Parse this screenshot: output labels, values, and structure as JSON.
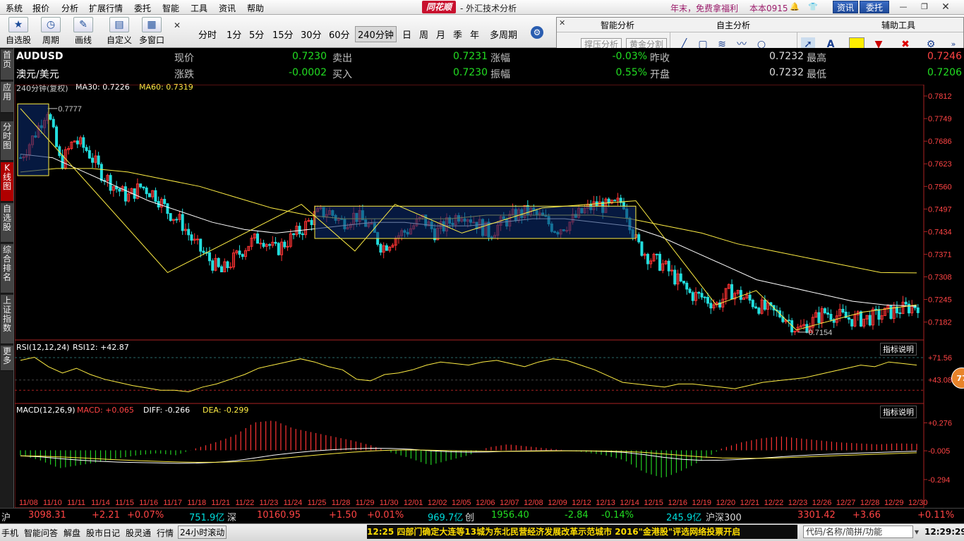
{
  "menu": {
    "items": [
      "系统",
      "报价",
      "分析",
      "扩展行情",
      "委托",
      "智能",
      "工具",
      "资讯",
      "帮助"
    ],
    "brand": "同花顺",
    "title": "- 外汇技术分析",
    "promo": "年末，免费拿福利",
    "user": "本本0915",
    "btn_news": "资讯",
    "btn_trade": "委托"
  },
  "toolbar": {
    "groups": [
      {
        "label": "自选股",
        "icon": "star-icon"
      },
      {
        "label": "周期",
        "icon": "clock-icon"
      },
      {
        "label": "画线",
        "icon": "pencil-icon"
      },
      {
        "label": "自定义",
        "icon": "custom-icon"
      },
      {
        "label": "多窗口",
        "icon": "window-icon"
      }
    ],
    "periods": [
      "分时",
      "1分",
      "5分",
      "15分",
      "30分",
      "60分",
      "240分钟",
      "日",
      "周",
      "月",
      "季",
      "年",
      "多周期"
    ],
    "active_period": "240分钟"
  },
  "panel": {
    "tabs": [
      "智能分析",
      "自主分析",
      "辅助工具"
    ],
    "buttons": [
      "撑压分析",
      "黄金分割"
    ],
    "tool_color": "#ffee00"
  },
  "sidetabs": [
    "首页",
    "应用",
    "分时图",
    "K线图",
    "自选股",
    "综合排名",
    "上证指数",
    "更多"
  ],
  "active_sidetab": "K线图",
  "quote": {
    "symbol": "AUDUSD",
    "name": "澳元/美元",
    "labels": [
      "现价",
      "涨跌",
      "卖出",
      "买入",
      "涨幅",
      "振幅",
      "昨收",
      "开盘",
      "最高",
      "最低"
    ],
    "current": "0.7230",
    "change": "-0.0002",
    "ask": "0.7231",
    "bid": "0.7230",
    "change_pct": "-0.03%",
    "amplitude": "0.55%",
    "prev_close": "0.7232",
    "open": "0.7232",
    "high": "0.7246",
    "low": "0.7206"
  },
  "chart_header": {
    "period": "240分钟(复权)",
    "ma30_label": "MA30: 0.7226",
    "ma60_label": "MA60: 0.7319"
  },
  "rsi_header": {
    "label": "RSI(12,12,24)",
    "value": "RSI12: +42.87",
    "help": "指标说明"
  },
  "macd_header": {
    "label": "MACD(12,26,9)",
    "macd": "MACD: +0.065",
    "diff": "DIFF: -0.266",
    "dea": "DEA: -0.299",
    "help": "指标说明"
  },
  "chart_data": [
    {
      "type": "candlestick",
      "ylim": [
        0.714,
        0.782
      ],
      "yticks": [
        "0.7812",
        "0.7749",
        "0.7686",
        "0.7623",
        "0.7560",
        "0.7497",
        "0.7434",
        "0.7371",
        "0.7308",
        "0.7245",
        "0.7182"
      ],
      "annotations": [
        {
          "text": "0.7777",
          "value": 0.7777
        },
        {
          "text": "0.7154",
          "value": 0.7154
        }
      ],
      "x_labels": [
        "11/08",
        "11/10",
        "11/11",
        "11/14",
        "11/15",
        "11/16",
        "11/17",
        "11/18",
        "11/21",
        "11/22",
        "11/23",
        "11/24",
        "11/25",
        "11/28",
        "11/29",
        "11/30",
        "12/01",
        "12/02",
        "12/05",
        "12/06",
        "12/07",
        "12/08",
        "12/09",
        "12/12",
        "12/13",
        "12/14",
        "12/15",
        "12/16",
        "12/19",
        "12/20",
        "12/21",
        "12/22",
        "12/23",
        "12/26",
        "12/27",
        "12/28",
        "12/29",
        "12/30"
      ],
      "anchor_prices": [
        0.764,
        0.77,
        0.7777,
        0.762,
        0.769,
        0.766,
        0.76,
        0.756,
        0.753,
        0.756,
        0.754,
        0.749,
        0.746,
        0.74,
        0.736,
        0.732,
        0.736,
        0.74,
        0.742,
        0.738,
        0.741,
        0.744,
        0.748,
        0.749,
        0.746,
        0.748,
        0.745,
        0.739,
        0.742,
        0.744,
        0.747,
        0.743,
        0.746,
        0.749,
        0.746,
        0.743,
        0.746,
        0.748,
        0.749,
        0.747,
        0.744,
        0.746,
        0.749,
        0.751,
        0.75,
        0.752,
        0.74,
        0.736,
        0.734,
        0.73,
        0.726,
        0.725,
        0.723,
        0.727,
        0.725,
        0.723,
        0.721,
        0.72,
        0.716,
        0.718,
        0.721,
        0.72,
        0.719,
        0.719,
        0.72,
        0.721,
        0.722,
        0.723
      ],
      "ma30": [
        0.765,
        0.764,
        0.76,
        0.756,
        0.752,
        0.749,
        0.746,
        0.744,
        0.743,
        0.744,
        0.745,
        0.746,
        0.746,
        0.745,
        0.745,
        0.746,
        0.747,
        0.747,
        0.746,
        0.745,
        0.742,
        0.738,
        0.734,
        0.73,
        0.728,
        0.726,
        0.724,
        0.723,
        0.7226
      ],
      "ma60": [
        0.76,
        0.761,
        0.761,
        0.76,
        0.758,
        0.756,
        0.753,
        0.75,
        0.748,
        0.747,
        0.747,
        0.747,
        0.747,
        0.748,
        0.748,
        0.748,
        0.748,
        0.747,
        0.745,
        0.743,
        0.74,
        0.738,
        0.736,
        0.734,
        0.732,
        0.7319
      ]
    },
    {
      "type": "line",
      "name": "RSI12",
      "ylim": [
        15,
        85
      ],
      "yticks": [
        "+71.56",
        "+43.08"
      ],
      "values": [
        68,
        72,
        60,
        52,
        58,
        50,
        44,
        40,
        36,
        33,
        30,
        30,
        28,
        34,
        38,
        44,
        50,
        58,
        62,
        66,
        70,
        66,
        60,
        56,
        44,
        42,
        50,
        52,
        56,
        62,
        66,
        64,
        62,
        66,
        68,
        64,
        60,
        66,
        70,
        68,
        62,
        56,
        48,
        40,
        38,
        36,
        34,
        38,
        38,
        36,
        34,
        32,
        36,
        40,
        42,
        44,
        46,
        50,
        54,
        58,
        62,
        60,
        66,
        64,
        62
      ]
    },
    {
      "type": "bar",
      "name": "MACD",
      "ylim": [
        -0.55,
        0.4
      ],
      "yticks": [
        "+0.276",
        "-0.005",
        "-0.294"
      ],
      "values": [
        -0.05,
        -0.1,
        -0.18,
        -0.15,
        -0.12,
        -0.08,
        -0.05,
        -0.03,
        -0.05,
        0.02,
        0.08,
        0.15,
        0.28,
        0.3,
        0.22,
        0.18,
        0.14,
        0.1,
        0.05,
        -0.02,
        -0.08,
        -0.15,
        -0.1,
        -0.05,
        0.03,
        0.06,
        0.04,
        0.02,
        0.0,
        -0.02,
        -0.05,
        -0.1,
        -0.22,
        -0.28,
        -0.2,
        -0.1,
        0.02,
        0.08,
        0.12,
        0.14,
        0.12,
        0.1,
        0.08,
        0.07,
        0.06,
        0.07,
        0.065
      ]
    }
  ],
  "status": {
    "sh_label": "沪",
    "sh_index": "3098.31",
    "sh_chg": "+2.21",
    "sh_pct": "+0.07%",
    "sh_amt": "751.9亿",
    "sz_label": "深",
    "sz_index": "10160.95",
    "sz_chg": "+1.50",
    "sz_pct": "+0.01%",
    "sz_amt": "969.7亿",
    "cy_label": "创",
    "cy_index": "1956.40",
    "cy_chg": "-2.84",
    "cy_pct": "-0.14%",
    "cy_amt": "245.9亿",
    "hs_label": "沪深300",
    "hs_index": "3301.42",
    "hs_chg": "+3.66",
    "hs_pct": "+0.11%"
  },
  "bottom": {
    "tabs": [
      "手机",
      "智能问答",
      "解盘",
      "股市日记",
      "股灵通",
      "行情",
      "24小时滚动"
    ],
    "news": "12:25  四部门确定大连等13城为东北民营经济发展改革示范城市          2016\"金港股\"评选网络投票开启",
    "code_placeholder": "代码/名称/简拼/功能",
    "clock": "12:29:29"
  },
  "float_badge": "77",
  "colors": {
    "up": "#ff3333",
    "down": "#22dddd",
    "ma30": "#ffffff",
    "ma60": "#ffee44",
    "green": "#22cc22"
  }
}
